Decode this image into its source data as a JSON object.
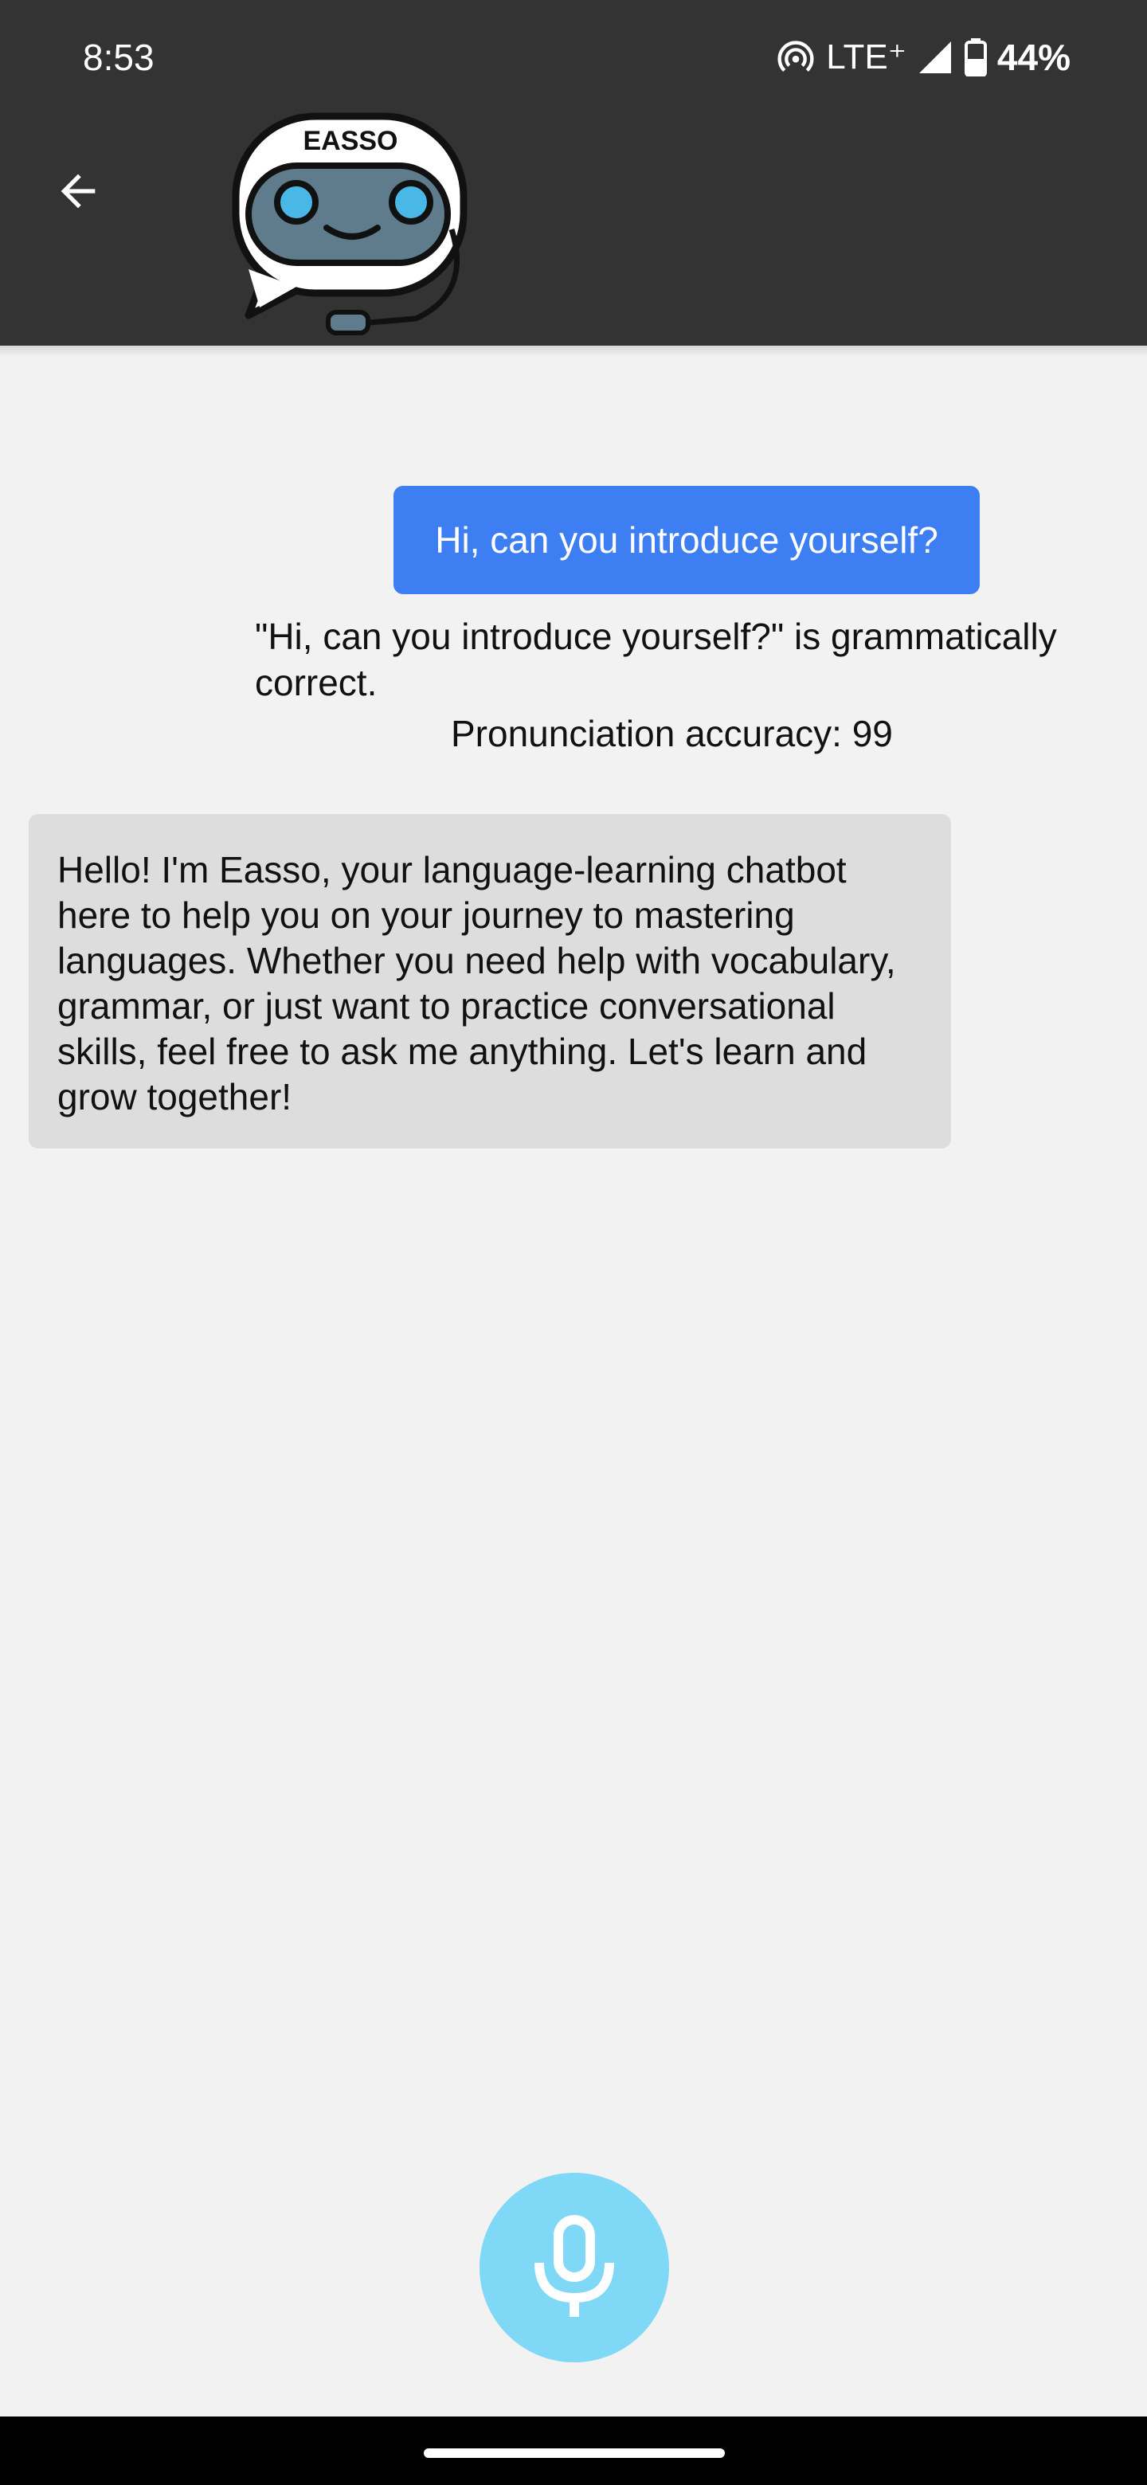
{
  "status_bar": {
    "time": "8:53",
    "network": "LTE⁺",
    "battery": "44%"
  },
  "header": {
    "logo_text": "EASSO",
    "background_color": "#333333"
  },
  "conversation": {
    "user_message": "Hi, can you introduce yourself?",
    "grammar_feedback": "\"Hi, can you introduce yourself?\" is grammatically correct.",
    "pronunciation_feedback": "Pronunciation accuracy: 99",
    "bot_message": "Hello! I'm Easso, your language-learning chatbot here to help you on your journey to mastering languages. Whether you need help with vocabulary, grammar, or just want to practice conversational skills, feel free to ask me anything. Let's learn and grow together!"
  },
  "colors": {
    "user_bubble": "#3d7ef2",
    "bot_bubble": "#dddddd",
    "mic_button": "#7fd8f6",
    "background": "#f2f2f2"
  },
  "icons": {
    "back": "arrow-left-icon",
    "mic": "microphone-icon",
    "hotspot": "hotspot-icon",
    "signal": "signal-icon",
    "battery": "battery-icon"
  }
}
